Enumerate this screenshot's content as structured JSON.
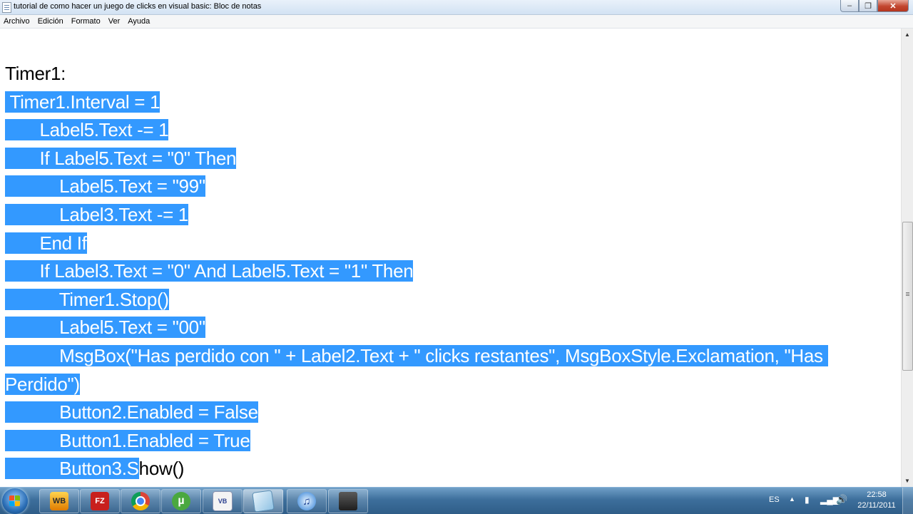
{
  "window": {
    "title": "tutorial de como hacer un juego de clicks en visual basic: Bloc de notas",
    "minimize_glyph": "–",
    "maximize_glyph": "❐",
    "close_glyph": "✕"
  },
  "menu": [
    "Archivo",
    "Edición",
    "Formato",
    "Ver",
    "Ayuda"
  ],
  "editor": {
    "lines": [
      {
        "pre": "Timer1:",
        "sel": "",
        "post": ""
      },
      {
        "pre": "",
        "sel": " Timer1.Interval = 1",
        "post": ""
      },
      {
        "pre": "",
        "sel": "       Label5.Text -= 1",
        "post": ""
      },
      {
        "pre": "",
        "sel": "       If Label5.Text = \"0\" Then",
        "post": ""
      },
      {
        "pre": "",
        "sel": "           Label5.Text = \"99\"",
        "post": ""
      },
      {
        "pre": "",
        "sel": "           Label3.Text -= 1",
        "post": ""
      },
      {
        "pre": "",
        "sel": "       End If",
        "post": ""
      },
      {
        "pre": "",
        "sel": "       If Label3.Text = \"0\" And Label5.Text = \"1\" Then",
        "post": ""
      },
      {
        "pre": "",
        "sel": "           Timer1.Stop()",
        "post": ""
      },
      {
        "pre": "",
        "sel": "           Label5.Text = \"00\"",
        "post": ""
      },
      {
        "pre": "",
        "sel": "           MsgBox(\"Has perdido con \" + Label2.Text + \" clicks restantes\", MsgBoxStyle.Exclamation, \"Has ",
        "post": ""
      },
      {
        "pre": "",
        "sel": "Perdido\")",
        "post": ""
      },
      {
        "pre": "",
        "sel": "           Button2.Enabled = False",
        "post": ""
      },
      {
        "pre": "",
        "sel": "           Button1.Enabled = True",
        "post": ""
      },
      {
        "pre": "",
        "sel": "           Button3.S",
        "post": "how()"
      }
    ]
  },
  "taskbar": {
    "apps": [
      {
        "name": "webcam-app-icon",
        "label": "WB"
      },
      {
        "name": "filezilla-icon",
        "label": "FZ"
      },
      {
        "name": "chrome-icon",
        "label": ""
      },
      {
        "name": "utorrent-icon",
        "label": "µ"
      },
      {
        "name": "visual-basic-icon",
        "label": "VB"
      },
      {
        "name": "notepad-icon",
        "label": ""
      },
      {
        "name": "itunes-icon",
        "label": "♫"
      },
      {
        "name": "camera-app-icon",
        "label": ""
      }
    ],
    "language": "ES",
    "time": "22:58",
    "date": "22/11/2011"
  },
  "colors": {
    "selection": "#3399ff",
    "taskbar": "#3d6f9c"
  }
}
